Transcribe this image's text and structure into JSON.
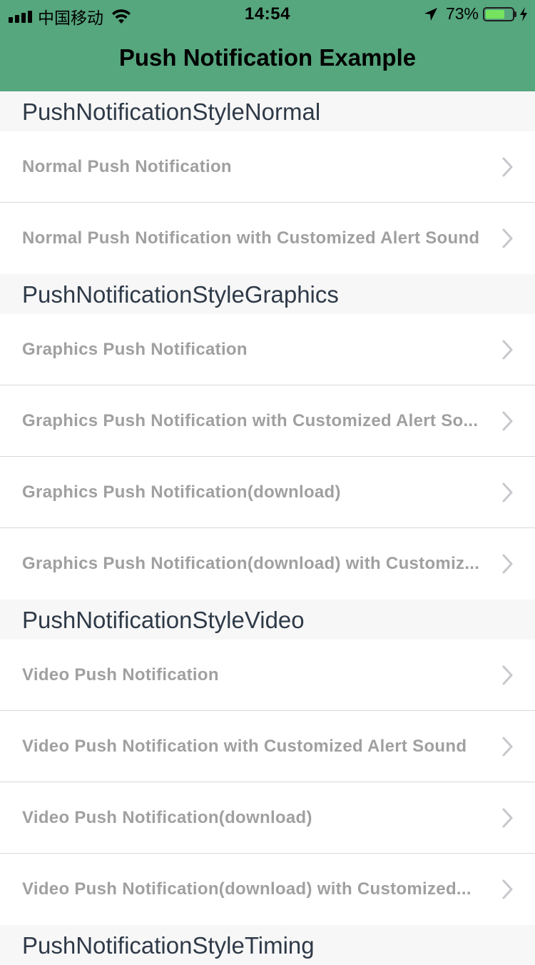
{
  "status_bar": {
    "carrier": "中国移动",
    "time": "14:54",
    "battery_percent_text": "73%",
    "battery_level": 0.73,
    "icons": [
      "signal-icon",
      "wifi-icon",
      "location-arrow-icon",
      "battery-icon",
      "charging-bolt-icon"
    ]
  },
  "nav": {
    "title": "Push Notification Example"
  },
  "colors": {
    "nav_bar": "#56a67e",
    "section_bg": "#f7f7f7",
    "row_text": "#a0a0a0",
    "section_text": "#2f3a48"
  },
  "sections": [
    {
      "title": "PushNotificationStyleNormal",
      "rows": [
        {
          "label": "Normal Push Notification"
        },
        {
          "label": "Normal Push Notification with Customized Alert Sound"
        }
      ]
    },
    {
      "title": "PushNotificationStyleGraphics",
      "rows": [
        {
          "label": "Graphics Push Notification"
        },
        {
          "label": "Graphics Push Notification with Customized Alert So..."
        },
        {
          "label": "Graphics Push Notification(download)"
        },
        {
          "label": "Graphics Push Notification(download) with Customiz..."
        }
      ]
    },
    {
      "title": "PushNotificationStyleVideo",
      "rows": [
        {
          "label": "Video Push Notification"
        },
        {
          "label": "Video Push Notification with Customized Alert Sound"
        },
        {
          "label": "Video Push Notification(download)"
        },
        {
          "label": "Video Push Notification(download) with Customized..."
        }
      ]
    },
    {
      "title": "PushNotificationStyleTiming",
      "rows": []
    }
  ]
}
